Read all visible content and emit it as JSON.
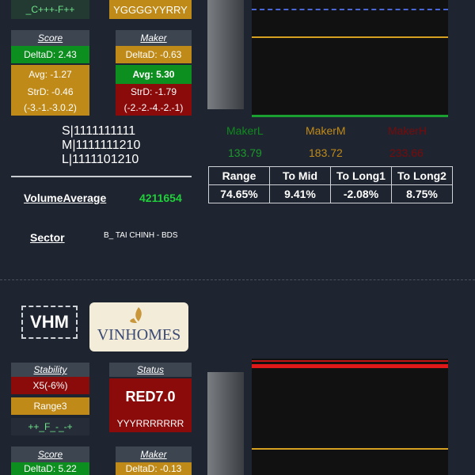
{
  "top": {
    "pattern_left": "_C+++-F++",
    "pattern_right": "YGGGGYYRRY"
  },
  "stock1": {
    "score": {
      "header": "Score",
      "delta": "DeltaD: 2.43",
      "avg": "Avg: -1.27",
      "strd": "StrD: -0.46",
      "range": "(-3.-1.-3.0.2)"
    },
    "maker": {
      "header": "Maker",
      "delta": "DeltaD: -0.63",
      "avg": "Avg: 5.30",
      "strd": "StrD: -1.79",
      "range": "(-2.-2.-4.-2.-1)"
    },
    "slm": {
      "s": "S|1111111111",
      "m": "M|1111111210",
      "l": "L|1111101210"
    },
    "volume_label": "VolumeAverage",
    "volume_value": "4211654",
    "sector_label": "Sector",
    "sector_value": "B_ TAI CHINH - BDS",
    "maker_levels": {
      "labels": [
        "MakerL",
        "MakerM",
        "MakerH"
      ],
      "values": [
        "133.79",
        "183.72",
        "233.66"
      ]
    },
    "stats": {
      "headers": [
        "Range",
        "To Mid",
        "To Long1",
        "To Long2"
      ],
      "values": [
        "74.65%",
        "9.41%",
        "-2.08%",
        "8.75%"
      ]
    }
  },
  "stock2": {
    "ticker": "VHM",
    "logo_text": "VINHOMES",
    "stability": {
      "header": "Stability",
      "x": "X5(-6%)",
      "range": "Range3",
      "pattern": "++_F_-_-+"
    },
    "status": {
      "header": "Status",
      "value": "RED7.0",
      "pattern": "YYYRRRRRRR"
    },
    "score": {
      "header": "Score",
      "delta": "DeltaD: 5.22"
    },
    "maker": {
      "header": "Maker",
      "delta": "DeltaD: -0.13"
    }
  },
  "colors": {
    "green": "#0d8f1f",
    "gold": "#c08a18",
    "red": "#8b0b0b",
    "bg": "#1f2530"
  }
}
